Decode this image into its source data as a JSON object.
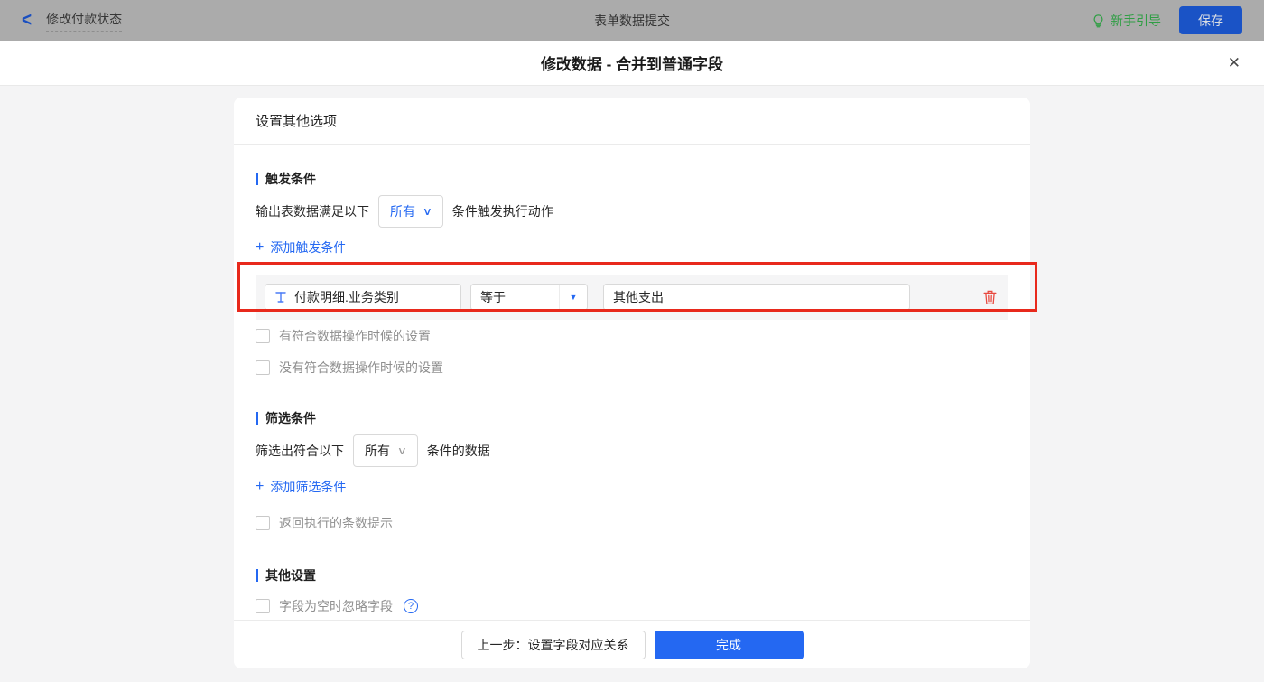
{
  "topbar": {
    "back": "修改付款状态",
    "title": "表单数据提交",
    "guide": "新手引导",
    "save": "保存"
  },
  "dialog": {
    "title": "修改数据 - 合并到普通字段"
  },
  "panel": {
    "header": "设置其他选项",
    "trigger": {
      "title": "触发条件",
      "prefix": "输出表数据满足以下",
      "scope": "所有",
      "suffix": "条件触发执行动作",
      "add": "添加触发条件",
      "row": {
        "field": "付款明细.业务类别",
        "operator": "等于",
        "value": "其他支出"
      },
      "cb_has": "有符合数据操作时候的设置",
      "cb_none": "没有符合数据操作时候的设置"
    },
    "filter": {
      "title": "筛选条件",
      "prefix": "筛选出符合以下",
      "scope": "所有",
      "suffix": "条件的数据",
      "add": "添加筛选条件",
      "cb_tip": "返回执行的条数提示"
    },
    "other": {
      "title": "其他设置",
      "cb_empty": "字段为空时忽略字段"
    }
  },
  "footer": {
    "prev": "上一步：设置字段对应关系",
    "done": "完成"
  },
  "icons": {
    "back": "<",
    "close": "✕",
    "plus": "+",
    "chevron_down": "∨",
    "dropdown_arrow": "▼",
    "help": "?"
  },
  "colors": {
    "accent": "#2468f2",
    "guide_green": "#2f9e44",
    "highlight_red": "#e8291c",
    "danger_red": "#e8493f",
    "topbar_bg": "#ababab"
  }
}
